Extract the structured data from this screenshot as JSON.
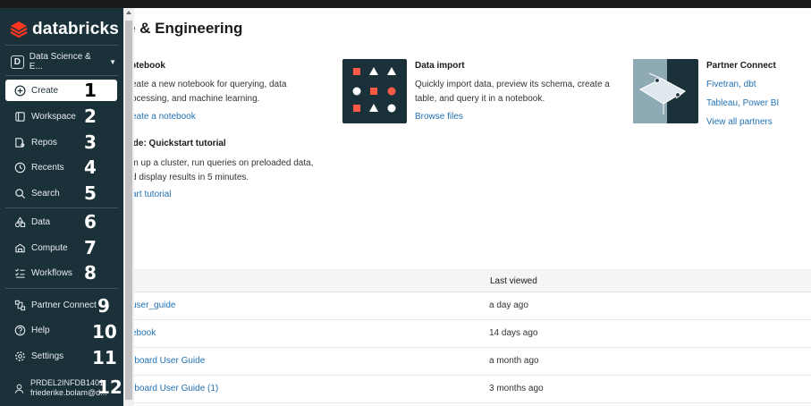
{
  "brand": {
    "name": "databricks"
  },
  "persona": {
    "badge": "D",
    "label": "Data Science & E..."
  },
  "nav": {
    "items": [
      {
        "label": "Create",
        "num": "1",
        "icon": "plus-circle-icon"
      },
      {
        "label": "Workspace",
        "num": "2",
        "icon": "workspace-icon"
      },
      {
        "label": "Repos",
        "num": "3",
        "icon": "repos-icon"
      },
      {
        "label": "Recents",
        "num": "4",
        "icon": "clock-icon"
      },
      {
        "label": "Search",
        "num": "5",
        "icon": "search-icon"
      },
      {
        "label": "Data",
        "num": "6",
        "icon": "data-icon"
      },
      {
        "label": "Compute",
        "num": "7",
        "icon": "compute-icon"
      },
      {
        "label": "Workflows",
        "num": "8",
        "icon": "workflows-icon"
      },
      {
        "label": "Partner Connect",
        "num": "9",
        "icon": "partner-connect-icon"
      },
      {
        "label": "Help",
        "num": "10",
        "icon": "help-icon"
      },
      {
        "label": "Settings",
        "num": "11",
        "icon": "gear-icon"
      }
    ]
  },
  "user": {
    "line1": "PRDEL2INFDB1401",
    "line2": "friederike.bolam@d...",
    "num": "12",
    "icon": "user-icon"
  },
  "page": {
    "title": "e & Engineering"
  },
  "cards": {
    "notebook": {
      "title": "otebook",
      "desc1": "eate a new notebook for querying, data",
      "desc2": "ocessing, and machine learning.",
      "link": "eate a notebook"
    },
    "guide": {
      "title": "ide: Quickstart tutorial",
      "desc1": "in up a cluster, run queries on preloaded data,",
      "desc2": "d display results in 5 minutes.",
      "link": "art tutorial"
    },
    "import": {
      "title": "Data import",
      "desc1": "Quickly import data, preview its schema, create a",
      "desc2": "table, and query it in a notebook.",
      "link": "Browse files"
    },
    "partner": {
      "title": "Partner Connect",
      "link1": "Fivetran, dbt",
      "link2": "Tableau, Power BI",
      "link3": "View all partners"
    }
  },
  "table": {
    "col_last_viewed": "Last viewed",
    "rows": [
      {
        "name": "user_guide",
        "time": "a day ago"
      },
      {
        "name": "ebook",
        "time": "14 days ago"
      },
      {
        "name": "rboard User Guide",
        "time": "a month ago"
      },
      {
        "name": "rboard User Guide (1)",
        "time": "3 months ago"
      }
    ]
  },
  "colors": {
    "sidebar": "#1b3139",
    "accent": "#ff3621",
    "link": "#2272b4"
  }
}
